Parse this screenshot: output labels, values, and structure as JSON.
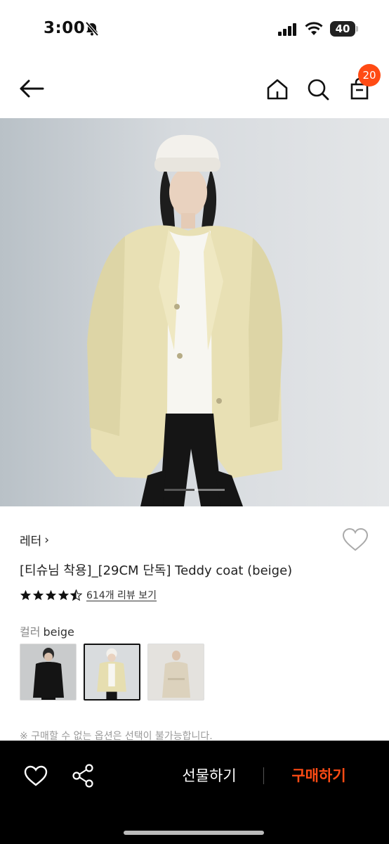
{
  "status_bar": {
    "time": "3:00",
    "battery": "40"
  },
  "header": {
    "cart_count": "20",
    "icons": [
      "back-arrow",
      "home",
      "search",
      "shopping-bag"
    ]
  },
  "product": {
    "brand": "레터",
    "brand_chevron": "›",
    "title": "[티슈님 착용]_[29CM 단독] Teddy coat (beige)",
    "rating": 4.5,
    "review_link": "614개 리뷰 보기"
  },
  "options": {
    "label": "컬러",
    "selected_value": "beige",
    "swatches": [
      {
        "name": "black",
        "selected": false
      },
      {
        "name": "beige",
        "selected": true
      },
      {
        "name": "light-beige",
        "selected": false
      }
    ]
  },
  "notice": "※ 구매할 수 없는 옵션은 선택이 불가능합니다.",
  "bottom_bar": {
    "gift_label": "선물하기",
    "buy_label": "구매하기"
  },
  "colors": {
    "accent": "#ff4b14",
    "bar_background": "#000000"
  }
}
